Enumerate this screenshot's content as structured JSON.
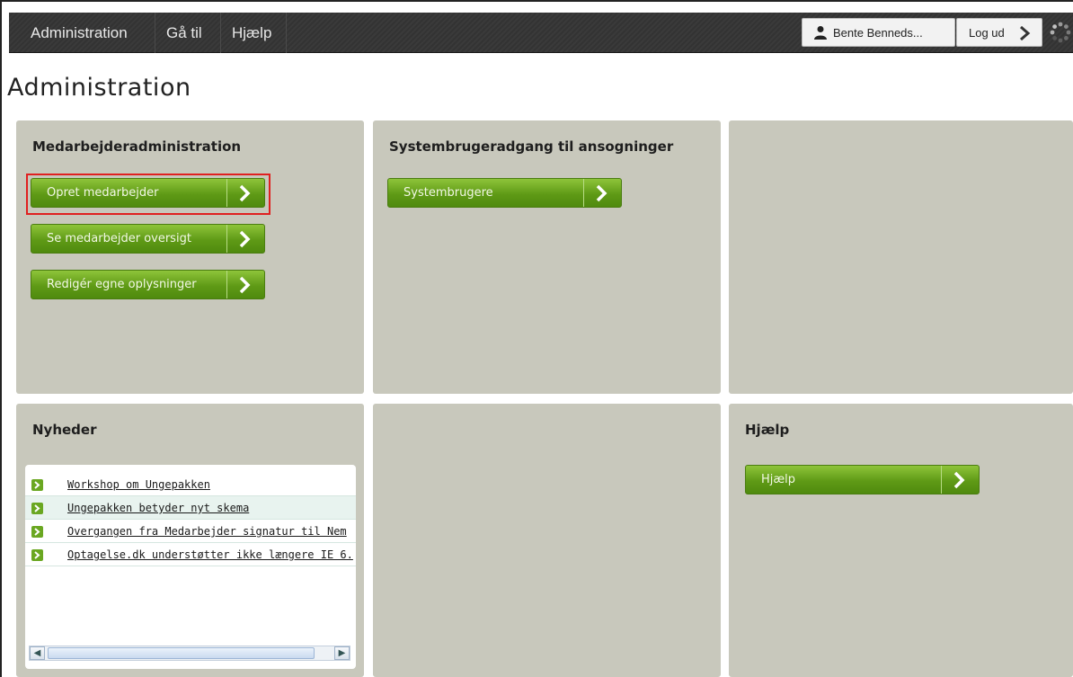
{
  "topbar": {
    "nav": [
      "Administration",
      "Gå til",
      "Hjælp"
    ],
    "user_name": "Bente Benneds...",
    "logout_label": "Log ud"
  },
  "page_title": "Administration",
  "panels": {
    "medarbejder": {
      "title": "Medarbejderadministration",
      "buttons": [
        "Opret medarbejder",
        "Se medarbejder oversigt",
        "Redigér egne oplysninger"
      ]
    },
    "system": {
      "title": "Systembrugeradgang til ansogninger",
      "buttons": [
        "Systembrugere"
      ]
    },
    "nyheder": {
      "title": "Nyheder",
      "items": [
        "Workshop om Ungepakken",
        "Ungepakken betyder nyt skema",
        "Overgangen fra Medarbejder signatur til Nem",
        "Optagelse.dk understøtter ikke længere IE 6."
      ]
    },
    "hjaelp": {
      "title": "Hjælp",
      "buttons": [
        "Hjælp"
      ]
    }
  },
  "colors": {
    "panel_bg": "#c8c8bc",
    "button_green": "#6aa721",
    "highlight_red": "#e02020",
    "topbar_bg": "#363636"
  }
}
